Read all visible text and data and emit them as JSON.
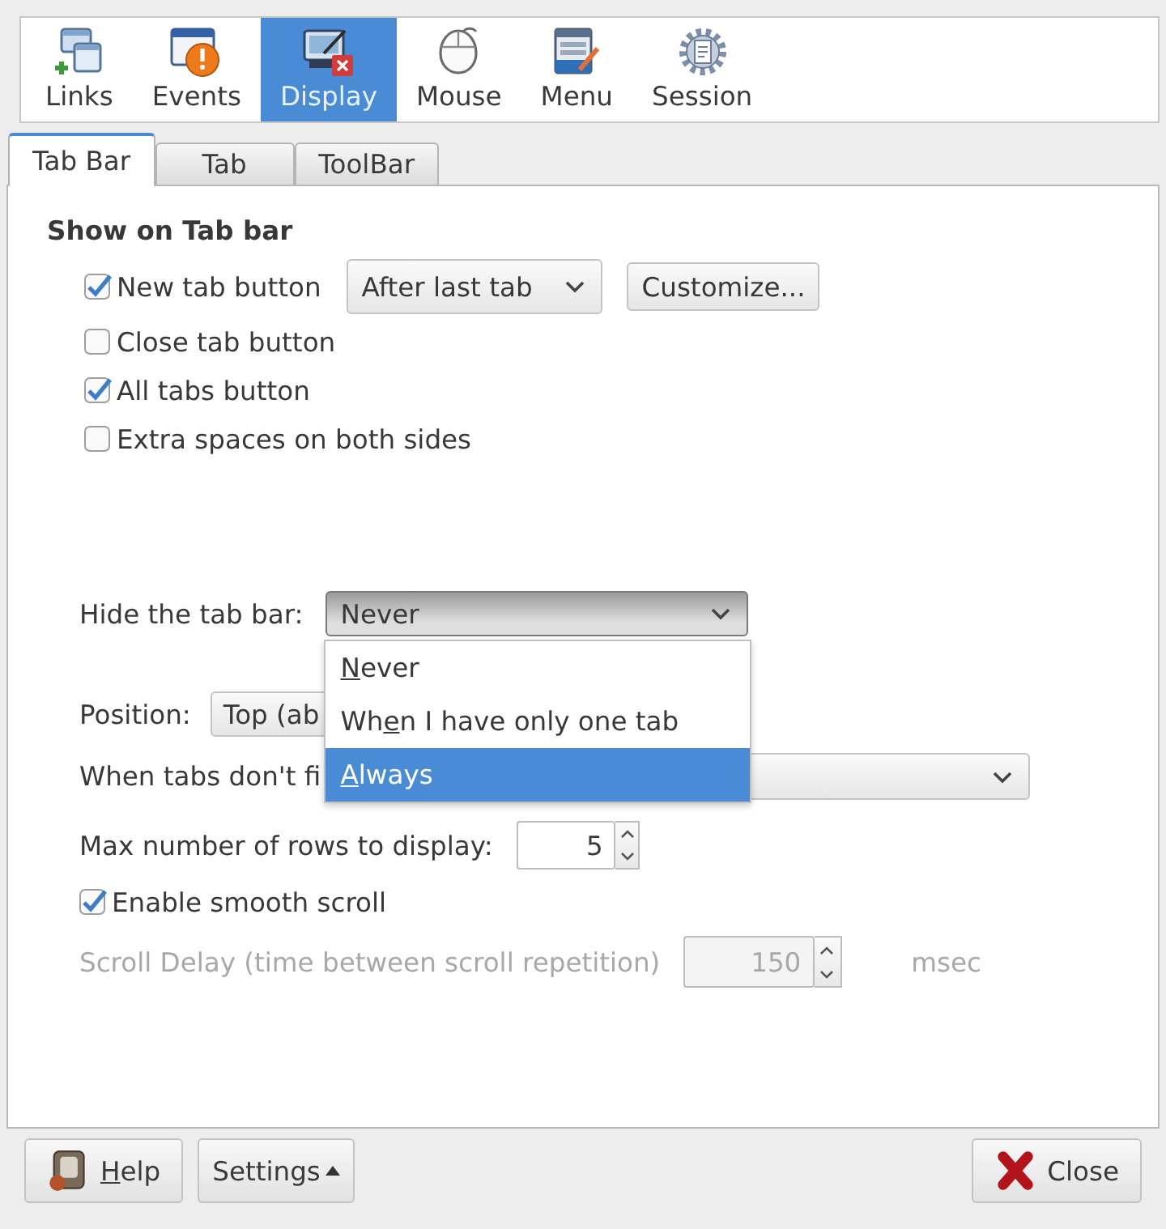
{
  "toolbar": {
    "items": [
      {
        "label": "Links",
        "selected": false
      },
      {
        "label": "Events",
        "selected": false
      },
      {
        "label": "Display",
        "selected": true
      },
      {
        "label": "Mouse",
        "selected": false
      },
      {
        "label": "Menu",
        "selected": false
      },
      {
        "label": "Session",
        "selected": false
      }
    ]
  },
  "tabs": [
    {
      "label": "Tab Bar",
      "selected": true
    },
    {
      "label": "Tab",
      "selected": false
    },
    {
      "label": "ToolBar",
      "selected": false
    }
  ],
  "show_on_tab_bar": {
    "heading": "Show on Tab bar",
    "options": [
      {
        "label": "New tab button",
        "checked": true,
        "dropdown": {
          "value": "After last tab"
        },
        "button": "Customize..."
      },
      {
        "label": "Close tab button",
        "checked": false
      },
      {
        "label": "All tabs button",
        "checked": true
      },
      {
        "label": "Extra spaces on both sides",
        "checked": false
      }
    ]
  },
  "hide_tab_bar": {
    "label": "Hide the tab bar:",
    "value": "Never",
    "open": true,
    "options": [
      {
        "mnemonic": "N",
        "rest": "ever",
        "selected": false
      },
      {
        "before": "Wh",
        "mnemonic": "e",
        "rest": "n I have only one tab",
        "selected": false
      },
      {
        "mnemonic": "A",
        "rest": "lways",
        "selected": true
      }
    ]
  },
  "position": {
    "label": "Position:",
    "value": "Top (ab"
  },
  "tabs_dont_fit": {
    "label": "When tabs don't fi"
  },
  "max_rows": {
    "label": "Max number of rows to display:",
    "value": "5"
  },
  "smooth_scroll": {
    "label": "Enable smooth scroll",
    "checked": true
  },
  "scroll_delay": {
    "label": "Scroll Delay (time between scroll repetition)",
    "value": "150",
    "unit": "msec",
    "disabled": true
  },
  "footer": {
    "buttons": [
      {
        "kind": "help",
        "mnemonic": "H",
        "rest": "elp"
      },
      {
        "kind": "menu",
        "label": "Settings"
      },
      {
        "kind": "close",
        "label": "Close"
      }
    ]
  }
}
